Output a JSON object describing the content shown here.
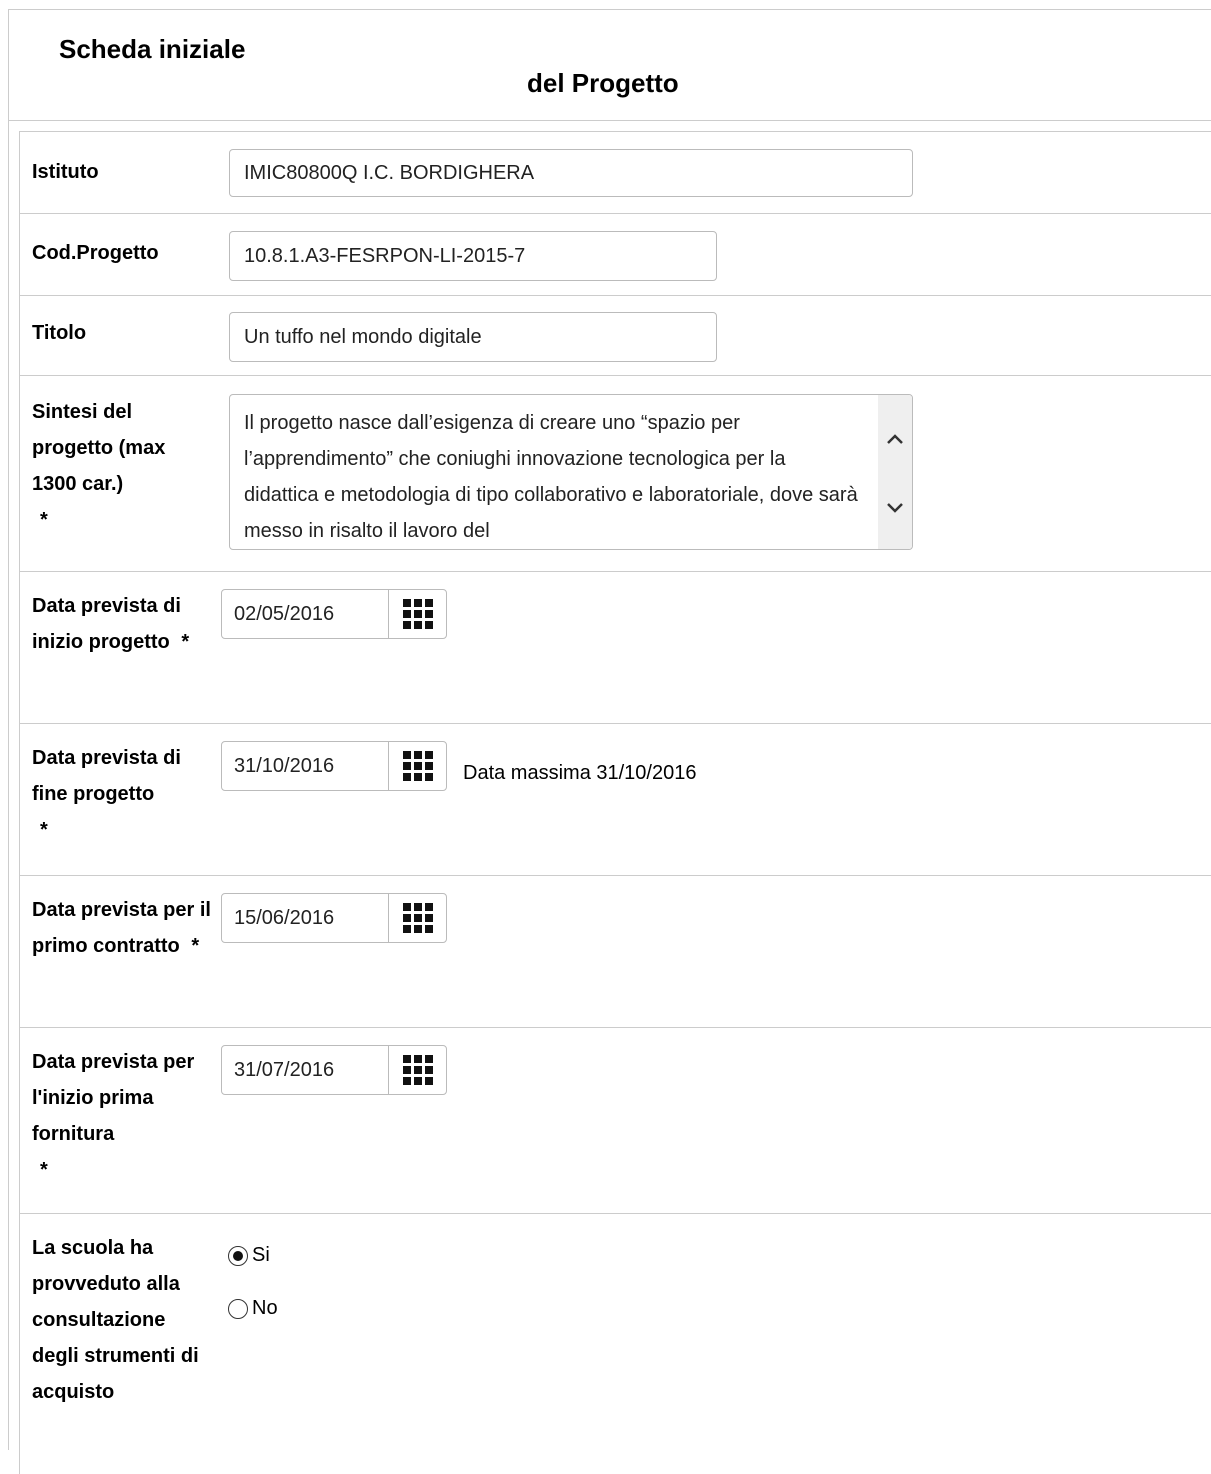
{
  "header": {
    "title_line1": "Scheda iniziale",
    "title_line2": "del Progetto"
  },
  "form": {
    "istituto": {
      "label": "Istituto",
      "value": "IMIC80800Q I.C. BORDIGHERA"
    },
    "cod_progetto": {
      "label": "Cod.Progetto",
      "value": "10.8.1.A3-FESRPON-LI-2015-7"
    },
    "titolo": {
      "label": "Titolo",
      "value": "Un tuffo nel mondo digitale"
    },
    "sintesi": {
      "label": "Sintesi del progetto (max 1300 car.)",
      "required_mark": "*",
      "value": "Il progetto nasce dall’esigenza di creare uno “spazio per l’apprendimento” che coniughi innovazione tecnologica per la didattica e metodologia di tipo collaborativo e laboratoriale, dove sarà messo in risalto il lavoro del"
    },
    "data_inizio": {
      "label": "Data prevista di inizio progetto",
      "required_mark": "*",
      "value": "02/05/2016"
    },
    "data_fine": {
      "label": "Data prevista di fine progetto",
      "required_mark": "*",
      "value": "31/10/2016",
      "note": "Data massima 31/10/2016"
    },
    "data_contratto": {
      "label": "Data prevista per il primo contratto",
      "required_mark": "*",
      "value": "15/06/2016"
    },
    "data_fornitura": {
      "label": "Data prevista per l'inizio prima fornitura",
      "required_mark": "*",
      "value": "31/07/2016"
    },
    "consultazione": {
      "label": "La scuola ha provveduto alla consultazione degli strumenti di acquisto",
      "options": [
        {
          "label": "Si",
          "selected": true
        },
        {
          "label": "No",
          "selected": false
        }
      ]
    }
  },
  "icons": {
    "calendar": "calendar-grid-icon",
    "scroll_up": "chevron-up-icon",
    "scroll_down": "chevron-down-icon"
  }
}
